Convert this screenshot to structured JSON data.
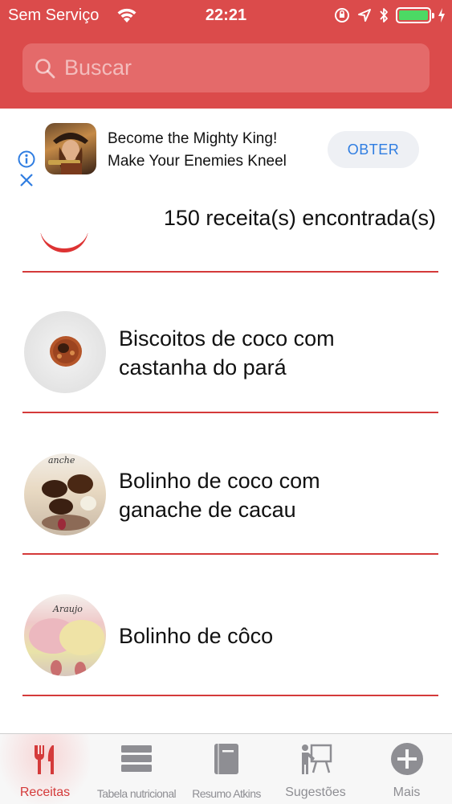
{
  "status_bar": {
    "carrier": "Sem Serviço",
    "time": "22:21",
    "battery_level": 1.0
  },
  "search": {
    "placeholder": "Buscar",
    "value": ""
  },
  "ad": {
    "line1": "Become the Mighty King!",
    "line2": "Make Your Enemies Kneel",
    "cta": "OBTER"
  },
  "list": {
    "count_label": "150 receita(s) encontrada(s)",
    "recipes": [
      {
        "name_line1": "Biscoitos de coco com",
        "name_line2": "castanha do pará"
      },
      {
        "name_line1": "Bolinho de coco com",
        "name_line2": "ganache de cacau",
        "thumb_caption": "anche"
      },
      {
        "name_line1": "Bolinho de côco",
        "name_line2": "",
        "thumb_caption": "Araujo"
      }
    ]
  },
  "tabbar": {
    "tabs": [
      {
        "label": "Receitas",
        "icon": "fork-knife-icon",
        "active": true
      },
      {
        "label": "Tabela nutricional",
        "icon": "table-icon",
        "active": false
      },
      {
        "label": "Resumo Atkins",
        "icon": "book-icon",
        "active": false
      },
      {
        "label": "Sugestões",
        "icon": "presentation-icon",
        "active": false
      },
      {
        "label": "Mais",
        "icon": "plus-circle-icon",
        "active": false
      }
    ]
  },
  "colors": {
    "header": "#db4b4b",
    "accent": "#d43a3a",
    "ad_button_text": "#2f7de1",
    "inactive_tab": "#8e8e93"
  }
}
